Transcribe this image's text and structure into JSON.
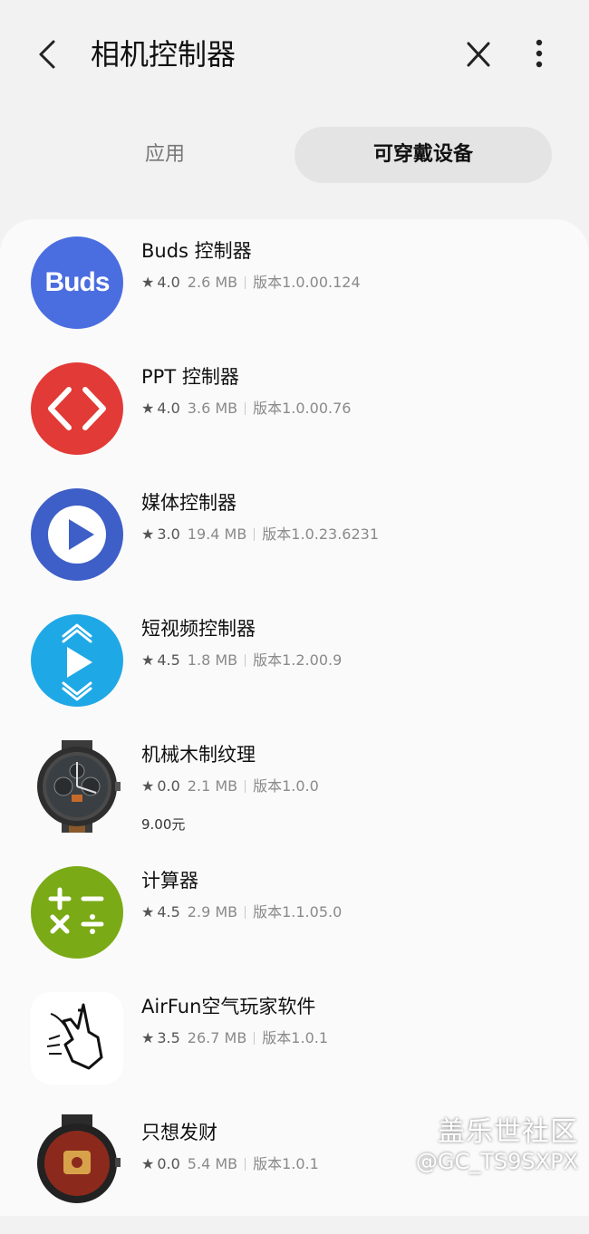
{
  "header": {
    "title": "相机控制器",
    "back_icon": "chevron-left",
    "close_icon": "close-x",
    "more_icon": "vertical-ellipsis"
  },
  "tabs": [
    {
      "label": "应用",
      "selected": false
    },
    {
      "label": "可穿戴设备",
      "selected": true
    }
  ],
  "apps": [
    {
      "name": "Buds 控制器",
      "rating": "4.0",
      "size": "2.6 MB",
      "version": "版本1.0.00.124",
      "icon": "buds-logo",
      "icon_text": "Buds",
      "color": "#4a6ee0"
    },
    {
      "name": "PPT 控制器",
      "rating": "4.0",
      "size": "3.6 MB",
      "version": "版本1.0.00.76",
      "icon": "code-brackets",
      "color": "#e23a36"
    },
    {
      "name": "媒体控制器",
      "rating": "3.0",
      "size": "19.4 MB",
      "version": "版本1.0.23.6231",
      "icon": "play-circle",
      "color": "#3d5fc7"
    },
    {
      "name": "短视频控制器",
      "rating": "4.5",
      "size": "1.8 MB",
      "version": "版本1.2.00.9",
      "icon": "short-video-play",
      "color": "#1fa8e6"
    },
    {
      "name": "机械木制纹理",
      "rating": "0.0",
      "size": "2.1 MB",
      "version": "版本1.0.0",
      "price": "9.00元",
      "icon": "watch-face-wood"
    },
    {
      "name": "计算器",
      "rating": "4.5",
      "size": "2.9 MB",
      "version": "版本1.1.05.0",
      "icon": "calculator",
      "color": "#7aaa16"
    },
    {
      "name": "AirFun空气玩家软件",
      "rating": "3.5",
      "size": "26.7 MB",
      "version": "版本1.0.1",
      "icon": "hand-gesture"
    },
    {
      "name": "只想发财",
      "rating": "0.0",
      "size": "5.4 MB",
      "version": "版本1.0.1",
      "icon": "watch-face-red"
    }
  ],
  "watermark": {
    "line1": "盖乐世社区",
    "line2": "@GC_TS9SXPX"
  }
}
